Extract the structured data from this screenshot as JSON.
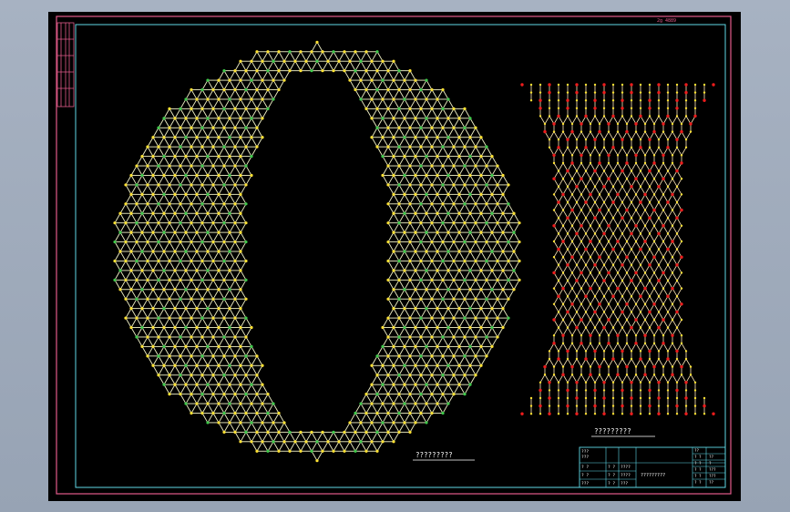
{
  "app": {
    "header_note": "2g 4889",
    "figure_caption_left": "?????????",
    "figure_caption_right": "?????????"
  },
  "title_block": {
    "rows": [
      [
        "? ?",
        "? ?",
        "????"
      ],
      [
        "? ?",
        "? ?",
        "????"
      ],
      [
        "???",
        "? ?",
        "???"
      ],
      [
        "???",
        "? ?",
        "????"
      ],
      [
        "???",
        "? ?",
        "????"
      ]
    ],
    "center_text": "?????????",
    "right_col": [
      "??",
      "? ?",
      "? ?",
      "? ?",
      "? ?",
      "? ?"
    ],
    "right_vals": [
      "",
      "??",
      "?",
      "???",
      "???",
      "??"
    ]
  },
  "colors": {
    "background": "#000000",
    "frame": "#e25b8a",
    "inner_frame": "#5fd8e6",
    "ring_bond": "#f2f2c8",
    "ring_atom_yellow": "#ffe233",
    "ring_atom_green": "#3ecb4a",
    "tube_atom_red": "#ee1c1c",
    "tube_bond": "#ffe9b8"
  }
}
